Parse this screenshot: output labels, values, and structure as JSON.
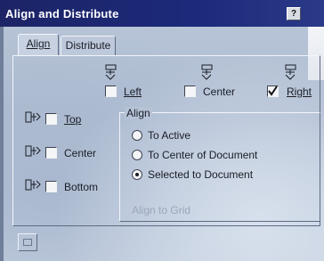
{
  "window": {
    "title": "Align and Distribute",
    "help_label": "?"
  },
  "tabs": [
    {
      "label": "Align",
      "active": true
    },
    {
      "label": "Distribute",
      "active": false
    }
  ],
  "horizontal": {
    "left_label": "Left",
    "left_checked": false,
    "center_label": "Center",
    "center_checked": false,
    "right_label": "Right",
    "right_checked": true
  },
  "vertical": {
    "top_label": "Top",
    "top_checked": false,
    "center_label": "Center",
    "center_checked": false,
    "bottom_label": "Bottom",
    "bottom_checked": false
  },
  "align_group": {
    "title": "Align",
    "options": [
      "To Active",
      "To Center of Document",
      "Selected to Document"
    ],
    "selected_index": 2
  },
  "align_button_label": "Align to Grid"
}
